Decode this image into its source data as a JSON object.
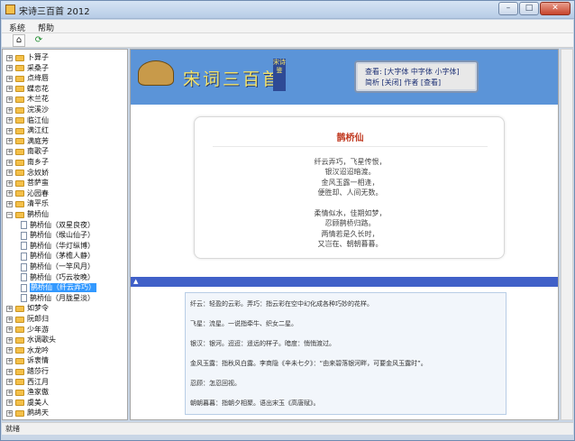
{
  "window": {
    "title": "宋诗三百首 2012",
    "minimize": "–",
    "maximize": "□",
    "close": "✕"
  },
  "menu": [
    "系统",
    "帮助"
  ],
  "toolbar": {
    "home_icon": "⌂",
    "refresh_icon": "⟳"
  },
  "tree": [
    {
      "label": "卜算子",
      "type": "folder",
      "exp": "+"
    },
    {
      "label": "采桑子",
      "type": "folder",
      "exp": "+"
    },
    {
      "label": "点绛唇",
      "type": "folder",
      "exp": "+"
    },
    {
      "label": "蝶恋花",
      "type": "folder",
      "exp": "+"
    },
    {
      "label": "木兰花",
      "type": "folder",
      "exp": "+"
    },
    {
      "label": "浣溪沙",
      "type": "folder",
      "exp": "+"
    },
    {
      "label": "临江仙",
      "type": "folder",
      "exp": "+"
    },
    {
      "label": "满江红",
      "type": "folder",
      "exp": "+"
    },
    {
      "label": "满庭芳",
      "type": "folder",
      "exp": "+"
    },
    {
      "label": "南歌子",
      "type": "folder",
      "exp": "+"
    },
    {
      "label": "南乡子",
      "type": "folder",
      "exp": "+"
    },
    {
      "label": "念奴娇",
      "type": "folder",
      "exp": "+"
    },
    {
      "label": "菩萨蛮",
      "type": "folder",
      "exp": "+"
    },
    {
      "label": "沁园春",
      "type": "folder",
      "exp": "+"
    },
    {
      "label": "清平乐",
      "type": "folder",
      "exp": "+"
    },
    {
      "label": "鹊桥仙",
      "type": "folder",
      "exp": "−"
    },
    {
      "label": "鹊桥仙（双星良夜）",
      "type": "page"
    },
    {
      "label": "鹊桥仙（缑山仙子）",
      "type": "page"
    },
    {
      "label": "鹊桥仙（华灯纵博）",
      "type": "page"
    },
    {
      "label": "鹊桥仙（茅檐人静）",
      "type": "page"
    },
    {
      "label": "鹊桥仙（一竿风月）",
      "type": "page"
    },
    {
      "label": "鹊桥仙（巧云妆晚）",
      "type": "page"
    },
    {
      "label": "鹊桥仙（纤云弄巧）",
      "type": "page",
      "selected": true
    },
    {
      "label": "鹊桥仙（月胧星淡）",
      "type": "page"
    },
    {
      "label": "如梦令",
      "type": "folder",
      "exp": "+"
    },
    {
      "label": "阮郎归",
      "type": "folder",
      "exp": "+"
    },
    {
      "label": "少年游",
      "type": "folder",
      "exp": "+"
    },
    {
      "label": "水调歌头",
      "type": "folder",
      "exp": "+"
    },
    {
      "label": "水龙吟",
      "type": "folder",
      "exp": "+"
    },
    {
      "label": "诉衷情",
      "type": "folder",
      "exp": "+"
    },
    {
      "label": "踏莎行",
      "type": "folder",
      "exp": "+"
    },
    {
      "label": "西江月",
      "type": "folder",
      "exp": "+"
    },
    {
      "label": "渔家傲",
      "type": "folder",
      "exp": "+"
    },
    {
      "label": "虞美人",
      "type": "folder",
      "exp": "+"
    },
    {
      "label": "鹧鸪天",
      "type": "folder",
      "exp": "+"
    }
  ],
  "banner": {
    "logo_text": "宋词三百首",
    "seal_text": "宋诗鉴",
    "nav_line1": "查看: [大字体  中字体  小字体]",
    "nav_line2": "简析  [关闭]  作者  [查看]"
  },
  "poem": {
    "title": "鹊桥仙",
    "lines": [
      "纤云弄巧，飞星传恨，",
      "银汉迢迢暗渡。",
      "金风玉露一相逢，",
      "便胜却、人间无数。",
      "",
      "柔情似水，佳期如梦，",
      "忍顾鹊桥归路。",
      "两情若是久长时，",
      "又岂在、朝朝暮暮。"
    ]
  },
  "splitter_arrow": "▲",
  "notes": [
    "纤云：轻盈的云彩。弄巧：指云彩在空中幻化成各种巧妙的花样。",
    "飞星：流星。一说指牵牛、织女二星。",
    "银汉：银河。迢迢：遥远的样子。暗度：悄悄渡过。",
    "金风玉露：指秋风白露。李商隐《辛未七夕》：“由来碧落银河畔，可要金风玉露时”。",
    "忍顾：怎忍回视。",
    "朝朝暮暮：指朝夕相聚。语出宋玉《高唐赋》。"
  ],
  "status": "就绪"
}
